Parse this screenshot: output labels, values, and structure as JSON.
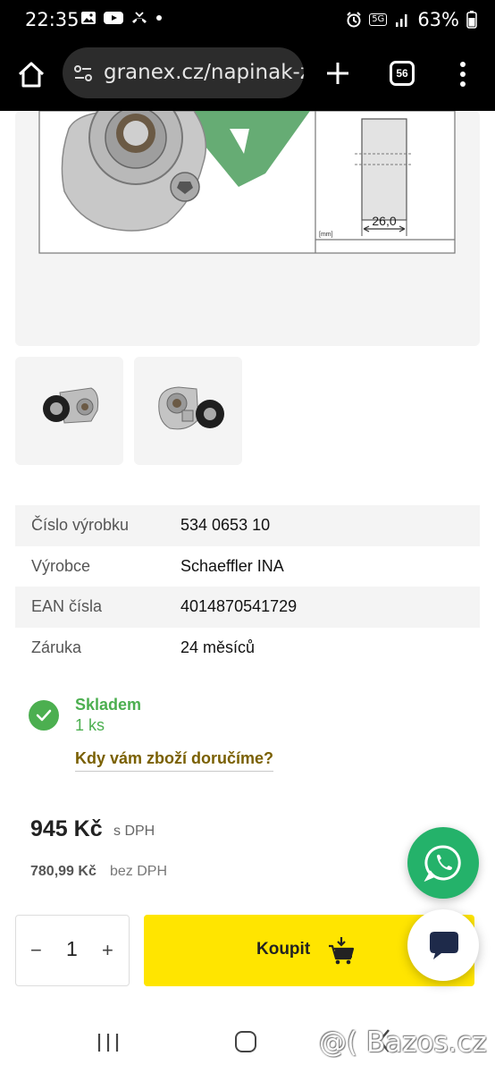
{
  "status_bar": {
    "time": "22:35",
    "network": "5G",
    "battery": "63%"
  },
  "browser": {
    "url": "granex.cz/napinak-ze",
    "tab_count": "56"
  },
  "product": {
    "drawing_dimension": "26,0",
    "drawing_unit": "[mm]"
  },
  "specs": [
    {
      "label": "Číslo výrobku",
      "value": "534 0653 10"
    },
    {
      "label": "Výrobce",
      "value": "Schaeffler INA"
    },
    {
      "label": "EAN čísla",
      "value": "4014870541729"
    },
    {
      "label": "Záruka",
      "value": "24 měsíců"
    }
  ],
  "stock": {
    "status": "Skladem",
    "quantity": "1 ks",
    "delivery_link": "Kdy vám zboží doručíme?"
  },
  "price": {
    "gross": "945 Kč",
    "gross_label": "s DPH",
    "net": "780,99 Kč",
    "net_label": "bez DPH"
  },
  "cart": {
    "minus": "−",
    "quantity": "1",
    "plus": "+",
    "buy_label": "Koupit"
  },
  "watermark": "@( Bazos.cz",
  "colors": {
    "accent_yellow": "#ffe500",
    "stock_green": "#4caf50",
    "whatsapp_green": "#24b26a",
    "link_brown": "#7a6000"
  }
}
